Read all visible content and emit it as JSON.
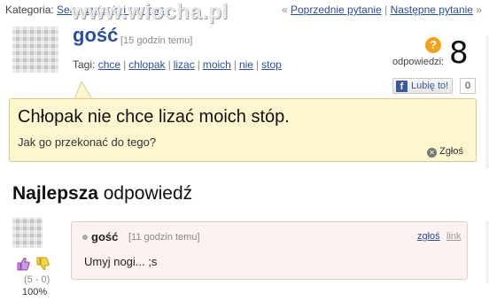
{
  "topbar": {
    "category_label": "Kategoria:",
    "category_link": "Seks, związki i romanse",
    "prev_link": "Poprzednie pytanie",
    "next_link": "Następne pytanie",
    "prev_arrow": "«",
    "next_arrow": "»",
    "separator": "|"
  },
  "watermark": "www.wiocha.pl",
  "question": {
    "author": "gość",
    "time": "[15 godzin temu]",
    "tags_label": "Tagi:",
    "tags": [
      "chce",
      "chlopak",
      "lizac",
      "moich",
      "nie",
      "stop"
    ],
    "title": "Chłopak nie chce lizać moich stóp.",
    "body": "Jak go przekonać do tego?",
    "report_label": "Zgłoś"
  },
  "answers": {
    "icon_glyph": "?",
    "count": "8",
    "label": "odpowiedzi:"
  },
  "like": {
    "icon_glyph": "f",
    "label": "Lubię to!",
    "count": "0"
  },
  "best_answer": {
    "heading_bold": "Najlepsza",
    "heading_rest": "odpowiedź",
    "author": "gość",
    "time": "[11 godzin temu]",
    "report_label": "zgłoś",
    "link_label": "link",
    "text": "Umyj nogi... ;s",
    "score": "(5 - 0)",
    "percent": "100%"
  },
  "colors": {
    "link": "#2a4f9e",
    "question_bg": "#fff6d0",
    "answer_bg": "#fdf2f2",
    "answers_badge": "#f4a21b",
    "vote_up": "#9b59b6",
    "vote_down": "#e0a800"
  },
  "icons": {
    "answers_badge": "question-mark-icon",
    "like": "facebook-icon",
    "report": "close-icon",
    "vote_up": "thumbs-up-icon",
    "vote_down": "thumbs-down-icon"
  }
}
